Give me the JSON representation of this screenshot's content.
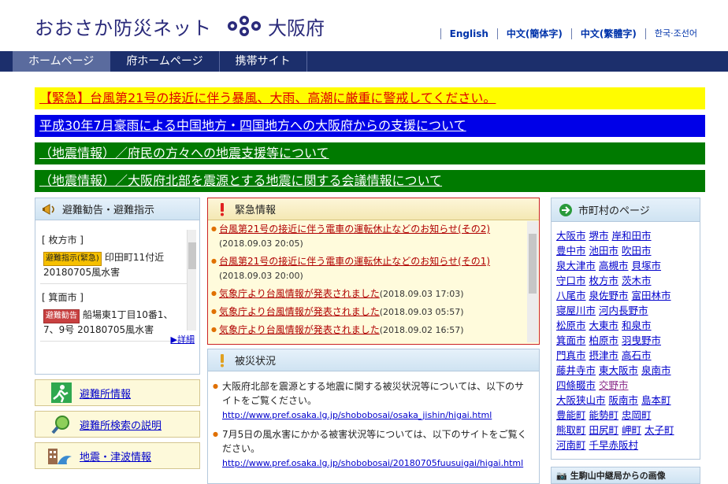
{
  "header": {
    "site_title": "おおさか防災ネット",
    "pref_name": "大阪府",
    "languages": [
      "English",
      "中文(簡体字)",
      "中文(繁體字)",
      "한국·조선어"
    ]
  },
  "nav": [
    "ホームページ",
    "府ホームページ",
    "携帯サイト"
  ],
  "banners": [
    "【緊急】台風第21号の接近に伴う暴風、大雨、高潮に厳重に警戒してください。",
    "平成30年7月豪雨による中国地方・四国地方への大阪府からの支援について",
    "（地震情報）／府民の方々への地震支援等について",
    "（地震情報）／大阪府北部を震源とする地震に関する会議情報について"
  ],
  "evac": {
    "title": "避難勧告・避難指示",
    "entries": [
      {
        "city": "[ 枚方市 ]",
        "tag": "避難指示(緊急)",
        "text": "印田町11付近 20180705風水害"
      },
      {
        "city": "[ 箕面市 ]",
        "tag": "避難勧告",
        "text": "船場東1丁目10番1、7、9号 20180705風水害"
      }
    ],
    "detail": "詳細"
  },
  "side_links": [
    "避難所情報",
    "避難所検索の説明",
    "地震・津波情報"
  ],
  "emergency": {
    "title": "緊急情報",
    "items": [
      {
        "text": "台風第21号の接近に伴う電車の運転休止などのお知らせ(その2)",
        "date": "(2018.09.03 20:05)"
      },
      {
        "text": "台風第21号の接近に伴う電車の運転休止などのお知らせ(その1)",
        "date": "(2018.09.03 20:00)"
      },
      {
        "text": "気象庁より台風情報が発表されました",
        "date": "(2018.09.03 17:03)"
      },
      {
        "text": "気象庁より台風情報が発表されました",
        "date": "(2018.09.03 05:57)"
      },
      {
        "text": "気象庁より台風情報が発表されました",
        "date": "(2018.09.02 16:57)"
      }
    ]
  },
  "damage": {
    "title": "被災状況",
    "items": [
      {
        "text": "大阪府北部を震源とする地震に関する被災状況等については、以下のサイトをご覧ください。",
        "url": "http://www.pref.osaka.lg.jp/shobobosai/osaka_jishin/higai.html"
      },
      {
        "text": "7月5日の風水害にかかる被害状況等については、以下のサイトをご覧ください。",
        "url": "http://www.pref.osaka.lg.jp/shobobosai/20180705fuusuigai/higai.html"
      }
    ]
  },
  "muni": {
    "title": "市町村のページ",
    "rows": [
      [
        "大阪市",
        "堺市",
        "岸和田市"
      ],
      [
        "豊中市",
        "池田市",
        "吹田市"
      ],
      [
        "泉大津市",
        "高槻市",
        "貝塚市"
      ],
      [
        "守口市",
        "枚方市",
        "茨木市"
      ],
      [
        "八尾市",
        "泉佐野市",
        "富田林市"
      ],
      [
        "寝屋川市",
        "河内長野市"
      ],
      [
        "松原市",
        "大東市",
        "和泉市"
      ],
      [
        "箕面市",
        "柏原市",
        "羽曳野市"
      ],
      [
        "門真市",
        "摂津市",
        "高石市"
      ],
      [
        "藤井寺市",
        "東大阪市",
        "泉南市"
      ],
      [
        "四條畷市",
        "交野市"
      ],
      [
        "大阪狭山市",
        "阪南市",
        "島本町"
      ],
      [
        "豊能町",
        "能勢町",
        "忠岡町"
      ],
      [
        "熊取町",
        "田尻町",
        "岬町",
        "太子町"
      ],
      [
        "河南町",
        "千早赤阪村"
      ]
    ],
    "visited": [
      "交野市"
    ]
  },
  "ikoma": "生駒山中継局からの画像",
  "colors": {
    "nav": "#1c2f6c",
    "banner_yellow": "#fffc00",
    "banner_blue": "#0000e8",
    "banner_green": "#007a00"
  }
}
